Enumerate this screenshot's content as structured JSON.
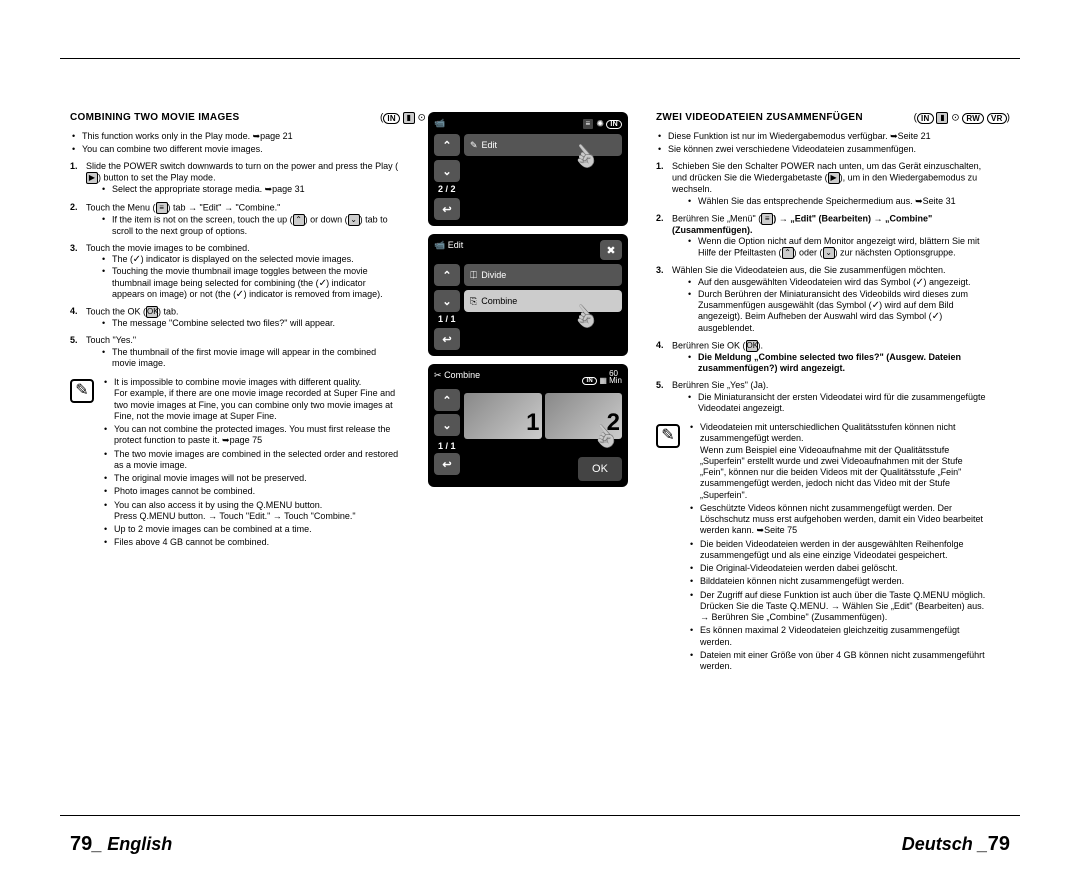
{
  "page_left": {
    "num": "79",
    "lang": "English"
  },
  "page_right": {
    "lang": "Deutsch",
    "num": "79"
  },
  "icon_strip": {
    "a": "IN",
    "b": "RW",
    "c": "VR"
  },
  "english": {
    "heading": "COMBINING TWO MOVIE IMAGES",
    "intro1": "This function works only in the Play mode. ➥page 21",
    "intro2": "You can combine two different movie images.",
    "s1": "Slide the POWER switch downwards to turn on the power and press the Play (",
    "s1b": ") button to set the Play mode.",
    "s1sub": "Select the appropriate storage media. ➥page 31",
    "s2": "Touch the Menu (",
    "s2b": ") tab → \"Edit\" → \"Combine.\"",
    "s2sub": "If the item is not on the screen, touch the up (",
    "s2sub_b": ") or down (",
    "s2sub_c": ") tab to scroll to the next group of options.",
    "s3": "Touch the movie images to be combined.",
    "s3sub1a": "The (",
    "s3sub1b": ") indicator is displayed on the selected movie images.",
    "s3sub2a": "Touching the movie thumbnail image toggles between the movie thumbnail image being selected for combining (the (",
    "s3sub2b": ") indicator appears on image) or not (the (",
    "s3sub2c": ") indicator is removed from image).",
    "s4": "Touch the OK (",
    "s4b": ") tab.",
    "s4sub": "The message \"Combine selected two files?\" will appear.",
    "s5": "Touch \"Yes.\"",
    "s5sub": "The thumbnail of the first movie image will appear in the combined movie image.",
    "n1": "It is impossible to combine movie images with different quality.",
    "n1b": "For example, if there are one movie image recorded at Super Fine and two movie images at Fine, you can combine only two movie images at Fine, not the movie image at Super Fine.",
    "n2": "You can not combine the protected images. You must first release the protect function to paste it. ➥page 75",
    "n3": "The two movie images are combined in the selected order and restored as a movie image.",
    "n4": "The original movie images will not be preserved.",
    "n5": "Photo images cannot be combined.",
    "n6a": "You can also access it by using the Q.MENU button.",
    "n6b": "Press Q.MENU button. → Touch \"Edit.\" → Touch \"Combine.\"",
    "n7": "Up to 2 movie images can be combined at a time.",
    "n8": "Files above 4 GB cannot be combined."
  },
  "german": {
    "heading": "ZWEI VIDEODATEIEN ZUSAMMENFÜGEN",
    "intro1": "Diese Funktion ist nur im Wiedergabemodus verfügbar. ➥Seite 21",
    "intro2": "Sie können zwei verschiedene Videodateien zusammenfügen.",
    "s1": "Schieben Sie den Schalter POWER nach unten, um das Gerät einzuschalten, und drücken Sie die Wiedergabetaste (",
    "s1b": "), um in den Wiedergabemodus zu wechseln.",
    "s1sub": "Wählen Sie das entsprechende Speichermedium aus. ➥Seite 31",
    "s2a": "Berühren Sie „Menü\" (",
    "s2b": ") → „Edit\" (Bearbeiten) → „Combine\" (Zusammenfügen).",
    "s2sub_a": "Wenn die Option nicht auf dem Monitor angezeigt wird, blättern Sie mit Hilfe der Pfeiltasten (",
    "s2sub_b": ") oder (",
    "s2sub_c": ") zur nächsten Optionsgruppe.",
    "s3": "Wählen Sie die Videodateien aus, die Sie zusammenfügen möchten.",
    "s3sub1a": "Auf den ausgewählten Videodateien wird das Symbol (",
    "s3sub1b": ") angezeigt.",
    "s3sub2a": "Durch Berühren der Miniaturansicht des Videobilds wird dieses zum Zusammenfügen ausgewählt (das Symbol (",
    "s3sub2b": ") wird auf dem Bild angezeigt). Beim Aufheben der Auswahl wird das Symbol (",
    "s3sub2c": ") ausgeblendet.",
    "s4a": "Berühren Sie OK (",
    "s4b": ").",
    "s4sub1": "Die Meldung „Combine selected two files?\" (Ausgew. Dateien zusammenfügen?) wird angezeigt.",
    "s5": "Berühren Sie „Yes\" (Ja).",
    "s5sub": "Die Miniaturansicht der ersten Videodatei wird für die zusammengefügte Videodatei angezeigt.",
    "n1a": "Videodateien mit unterschiedlichen Qualitätsstufen können nicht zusammengefügt werden.",
    "n1b": "Wenn zum Beispiel eine Videoaufnahme mit der Qualitätsstufe „Superfein\" erstellt wurde und zwei Videoaufnahmen mit der Stufe „Fein\", können nur die beiden Videos mit der Qualitätsstufe „Fein\" zusammengefügt werden, jedoch nicht das Video mit der Stufe „Superfein\".",
    "n2": "Geschützte Videos können nicht zusammengefügt werden. Der Löschschutz muss erst aufgehoben werden, damit ein Video bearbeitet werden kann. ➥Seite 75",
    "n3": "Die beiden Videodateien werden in der ausgewählten Reihenfolge zusammengefügt und als eine einzige Videodatei gespeichert.",
    "n4": "Die Original-Videodateien werden dabei gelöscht.",
    "n5": "Bilddateien können nicht zusammengefügt werden.",
    "n6": "Der Zugriff auf diese Funktion ist auch über die Taste Q.MENU möglich. Drücken Sie die Taste Q.MENU. → Wählen Sie „Edit\" (Bearbeiten) aus. → Berühren Sie „Combine\" (Zusammenfügen).",
    "n7": "Es können maximal 2 Videodateien gleichzeitig zusammengefügt werden.",
    "n8": "Dateien mit einer Größe von über 4 GB können nicht zusammengeführt werden."
  },
  "lcd1": {
    "edit": "Edit",
    "count": "2 / 2"
  },
  "lcd2": {
    "title": "Edit",
    "divide": "Divide",
    "combine": "Combine",
    "count": "1 / 1"
  },
  "lcd3": {
    "title": "Combine",
    "min": "60\nMin",
    "count": "1 / 1",
    "ok": "OK",
    "t1": "1",
    "t2": "2"
  }
}
